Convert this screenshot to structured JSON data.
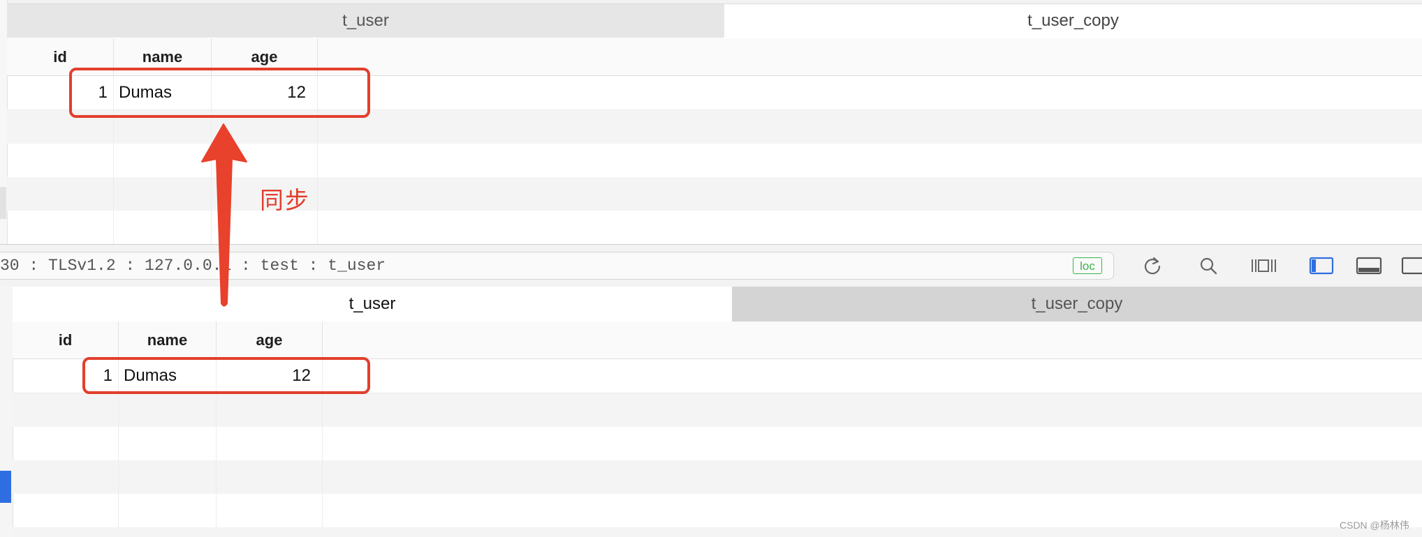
{
  "top_window": {
    "tabs": [
      {
        "label": "t_user",
        "active": false
      },
      {
        "label": "t_user_copy",
        "active": true
      }
    ],
    "columns": [
      "id",
      "name",
      "age"
    ],
    "rows": [
      {
        "id": "1",
        "name": "Dumas",
        "age": "12"
      }
    ]
  },
  "bottom_window": {
    "connection_text": "30 : TLSv1.2 : 127.0.0.1 : test : t_user",
    "loc_badge": "loc",
    "toolbar_icons": [
      "refresh-icon",
      "search-icon",
      "columns-icon",
      "sidebar-left-icon",
      "panel-bottom-icon",
      "sidebar-right-icon"
    ],
    "tabs": [
      {
        "label": "t_user",
        "active": true
      },
      {
        "label": "t_user_copy",
        "active": false
      }
    ],
    "columns": [
      "id",
      "name",
      "age"
    ],
    "rows": [
      {
        "id": "1",
        "name": "Dumas",
        "age": "12"
      }
    ]
  },
  "annotation": {
    "text": "同步",
    "color": "#e23f2c"
  },
  "watermark": "CSDN @杨林伟",
  "colors": {
    "annotation_red": "#e23f2c",
    "loc_green": "#3bb24a",
    "selection_blue": "#2f6ee0"
  }
}
